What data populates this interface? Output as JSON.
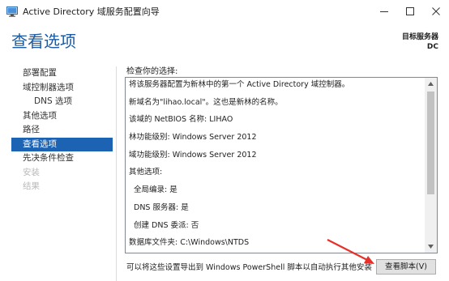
{
  "window": {
    "title": "Active Directory 域服务配置向导",
    "icon": "server-wizard-icon",
    "controls": [
      "minimize-icon",
      "maximize-icon",
      "close-icon"
    ]
  },
  "header": {
    "page_title": "查看选项",
    "target_server_label": "目标服务器",
    "target_server_value": "DC"
  },
  "nav": {
    "items": [
      {
        "label": "部署配置",
        "state": "normal"
      },
      {
        "label": "域控制器选项",
        "state": "normal"
      },
      {
        "label": "DNS 选项",
        "state": "normal"
      },
      {
        "label": "其他选项",
        "state": "normal"
      },
      {
        "label": "路径",
        "state": "normal"
      },
      {
        "label": "查看选项",
        "state": "active"
      },
      {
        "label": "先决条件检查",
        "state": "normal"
      },
      {
        "label": "安装",
        "state": "disabled"
      },
      {
        "label": "结果",
        "state": "disabled"
      }
    ]
  },
  "review": {
    "label": "检查你的选择:",
    "lines": [
      "将该服务器配置为新林中的第一个 Active Directory 域控制器。",
      "新域名为\"lihao.local\"。这也是新林的名称。",
      "该域的 NetBIOS 名称: LIHAO",
      "林功能级别: Windows Server 2012",
      "域功能级别: Windows Server 2012",
      "其他选项:",
      "全局编录: 是",
      "DNS 服务器: 是",
      "创建 DNS 委派: 否",
      "数据库文件夹: C:\\Windows\\NTDS"
    ]
  },
  "footer": {
    "export_text": "可以将这些设置导出到 Windows PowerShell 脚本以自动执行其他安装",
    "view_script_button": "查看脚本(V)"
  },
  "colors": {
    "accent": "#1c63b3",
    "title_blue": "#1e5aa0",
    "disabled_text": "#b9b9b9",
    "annotation_arrow": "#e8302a"
  }
}
